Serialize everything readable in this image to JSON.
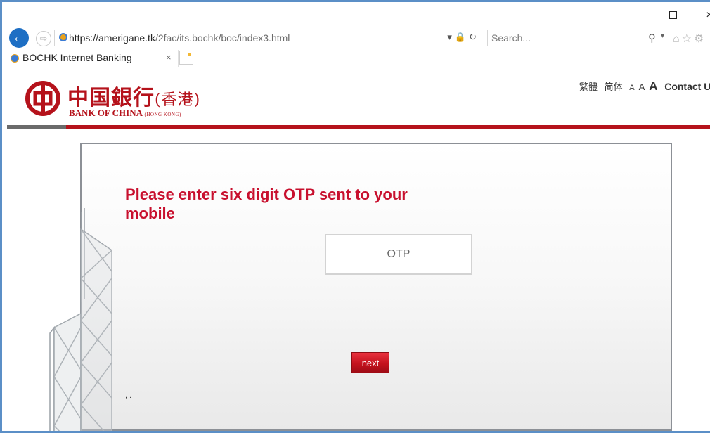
{
  "browser": {
    "url_host": "https://amerigane.tk",
    "url_path": "/2fac/its.bochk/boc/index3.html",
    "search_placeholder": "Search...",
    "tab_title": "BOCHK Internet Banking",
    "tab_close": "×",
    "window_close": "×",
    "icons": [
      "back-arrow-icon",
      "forward-arrow-icon",
      "lock-icon",
      "refresh-icon",
      "search-icon",
      "home-icon",
      "star-icon",
      "gear-icon"
    ]
  },
  "header": {
    "logo_cn": "中国銀行",
    "logo_cn_hk": "(香港)",
    "logo_en": "BANK OF CHINA",
    "logo_en_hk": "(HONG KONG)",
    "lang_traditional": "繁體",
    "lang_simplified": "简体",
    "font_small": "A",
    "font_medium": "A",
    "font_large": "A",
    "contact": "Contact Us"
  },
  "form": {
    "title": "Please enter six digit OTP sent to your mobile",
    "otp_placeholder": "OTP",
    "otp_value": "",
    "next_label": "next",
    "footnote": ", ."
  },
  "colors": {
    "brand_red": "#b5121b",
    "title_red": "#c8102e",
    "browser_blue": "#1e6fc4"
  }
}
